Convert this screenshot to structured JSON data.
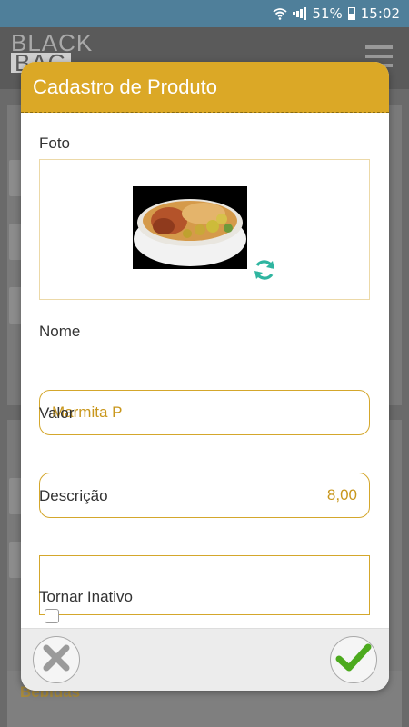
{
  "status_bar": {
    "battery_percent": "51%",
    "time": "15:02",
    "icons": [
      "wifi-icon",
      "signal-icon",
      "battery-icon"
    ]
  },
  "app": {
    "logo_line1": "BLACK",
    "logo_line2": "BAG",
    "menu_icon": "hamburger-menu-icon",
    "background_section": "Bebidas"
  },
  "modal": {
    "title": "Cadastro de Produto",
    "photo_label": "Foto",
    "photo_refresh_icon": "refresh-icon",
    "name_label": "Nome",
    "name_value": "Marmita P",
    "value_label": "Valor",
    "value_value": "8,00",
    "description_label": "Descrição",
    "description_value": "",
    "inactive_label": "Tornar Inativo",
    "inactive_checked": false,
    "cancel_icon": "close-icon",
    "confirm_icon": "check-icon"
  },
  "colors": {
    "accent": "#dba826",
    "status_bar": "#4f7f9a",
    "input_text": "#c9971c",
    "refresh": "#2fb5a0",
    "confirm": "#4caa1e"
  }
}
